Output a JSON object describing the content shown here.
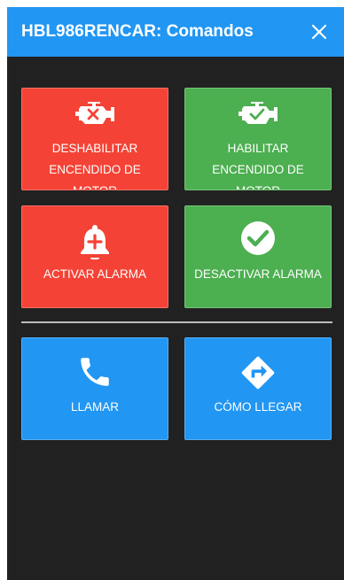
{
  "dialog": {
    "title": "HBL986RENCAR: Comandos",
    "close_label": "✕"
  },
  "commands": {
    "disable_ignition": "DESHABILITAR ENCENDIDO DE MOTOR",
    "enable_ignition": "HABILITAR ENCENDIDO DE MOTOR",
    "activate_alarm": "ACTIVAR ALARMA",
    "deactivate_alarm": "DESACTIVAR ALARMA",
    "call": "LLAMAR",
    "directions": "CÓMO LLEGAR"
  },
  "colors": {
    "header": "#2196f3",
    "danger": "#f44336",
    "success": "#4caf50",
    "primary": "#2196f3",
    "background": "#212121"
  },
  "icons": {
    "disable_ignition": "engine-x-icon",
    "enable_ignition": "engine-check-icon",
    "activate_alarm": "bell-plus-icon",
    "deactivate_alarm": "check-circle-icon",
    "call": "phone-icon",
    "directions": "directions-icon"
  }
}
